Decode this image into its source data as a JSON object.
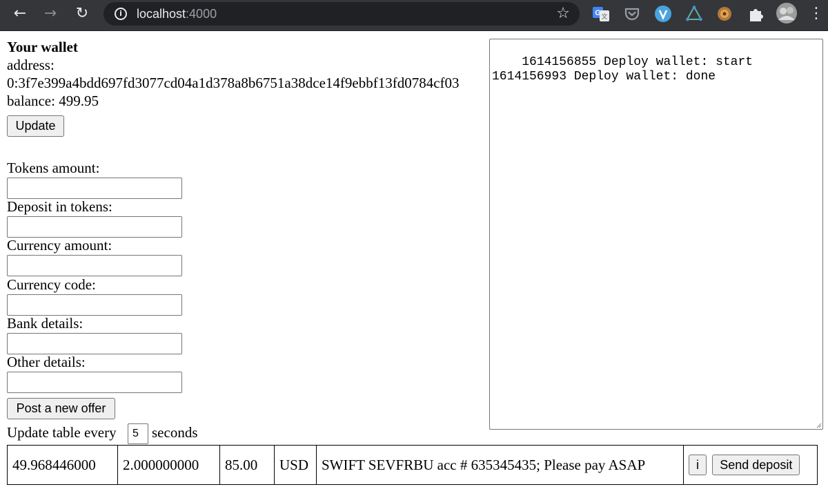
{
  "browser": {
    "url_host": "localhost",
    "url_port": ":4000"
  },
  "wallet": {
    "title": "Your wallet",
    "address_label": "address:",
    "address_value": "0:3f7e399a4bdd697fd3077cd04a1d378a8b6751a38dce14f9ebbf13fd0784cf03",
    "balance_text": "balance: 499.95",
    "update_button": "Update"
  },
  "form": {
    "tokens_amount_label": "Tokens amount:",
    "deposit_label": "Deposit in tokens:",
    "currency_amount_label": "Currency amount:",
    "currency_code_label": "Currency code:",
    "bank_details_label": "Bank details:",
    "other_details_label": "Other details:",
    "post_button": "Post a new offer"
  },
  "log": {
    "text": "1614156855 Deploy wallet: start\n1614156993 Deploy wallet: done"
  },
  "refresh": {
    "prefix": "Update table every",
    "value": "5",
    "suffix": "seconds"
  },
  "offers": [
    {
      "tokens": "49.968446000",
      "deposit": "2.000000000",
      "amount": "85.00",
      "currency": "USD",
      "details": "SWIFT SEVFRBU acc # 635345435; Please pay ASAP",
      "info_button": "i",
      "send_button": "Send deposit"
    }
  ]
}
